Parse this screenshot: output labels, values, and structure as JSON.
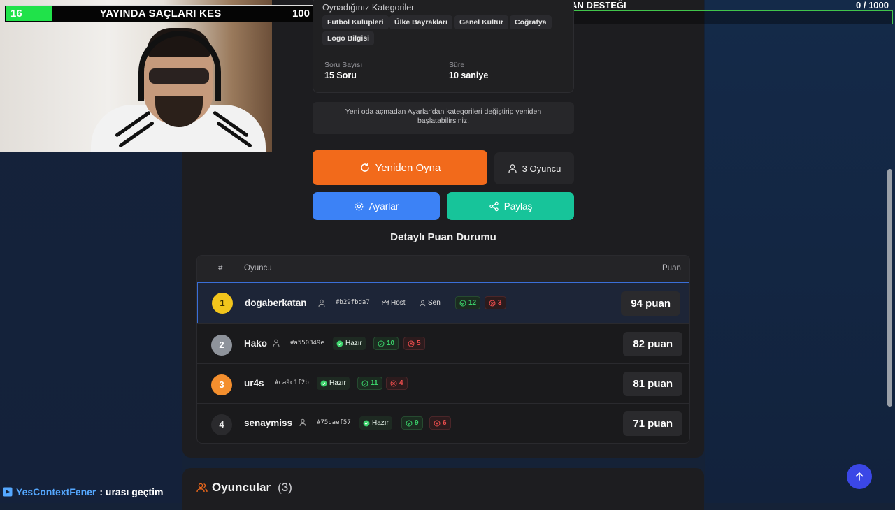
{
  "overlay": {
    "left_counter": "16",
    "title": "YAYINDA SAÇLARI KES",
    "right_counter": "100",
    "donation_label": "EKIPMAN DESTEĞI",
    "donation_count": "0  / 1000"
  },
  "categories": {
    "title": "Oynadığınız Kategoriler",
    "chips": [
      "Futbol Kulüpleri",
      "Ülke Bayrakları",
      "Genel Kültür",
      "Coğrafya",
      "Logo Bilgisi"
    ],
    "question_count_label": "Soru Sayısı",
    "question_count_value": "15 Soru",
    "duration_label": "Süre",
    "duration_value": "10 saniye"
  },
  "note": "Yeni oda açmadan Ayarlar'dan kategorileri değiştirip yeniden başlatabilirsiniz.",
  "actions": {
    "replay": "Yeniden Oyna",
    "players": "3 Oyuncu",
    "settings": "Ayarlar",
    "share": "Paylaş"
  },
  "scoreboard": {
    "title": "Detaylı Puan Durumu",
    "col_rank": "#",
    "col_player": "Oyuncu",
    "col_points": "Puan",
    "host_label": "Host",
    "you_label": "Sen",
    "ready_label": "Hazır",
    "rows": [
      {
        "rank": "1",
        "name": "dogaberkatan",
        "id": "#b29fbda7",
        "correct": "12",
        "wrong": "3",
        "points": "94 puan"
      },
      {
        "rank": "2",
        "name": "Hako",
        "id": "#a550349e",
        "correct": "10",
        "wrong": "5",
        "points": "82 puan"
      },
      {
        "rank": "3",
        "name": "ur4s",
        "id": "#ca9c1f2b",
        "correct": "11",
        "wrong": "4",
        "points": "81 puan"
      },
      {
        "rank": "4",
        "name": "senaymiss",
        "id": "#75caef57",
        "correct": "9",
        "wrong": "6",
        "points": "71 puan"
      }
    ]
  },
  "players_section": {
    "title": "Oyuncular",
    "count": "(3)"
  },
  "chat": {
    "user": "YesContextFener",
    "message": ": urası geçtim"
  },
  "colors": {
    "accent_orange": "#f26a1b",
    "accent_blue": "#3c82f6",
    "accent_teal": "#17c49a",
    "gold": "#f2c51c",
    "silver": "#8e939b",
    "bronze": "#f48f2e"
  },
  "icons": [
    "refresh-icon",
    "user-icon",
    "gear-icon",
    "share-icon",
    "crown-icon",
    "check-circle-icon",
    "x-circle-icon",
    "users-icon",
    "arrow-up-icon",
    "twitch-icon"
  ]
}
